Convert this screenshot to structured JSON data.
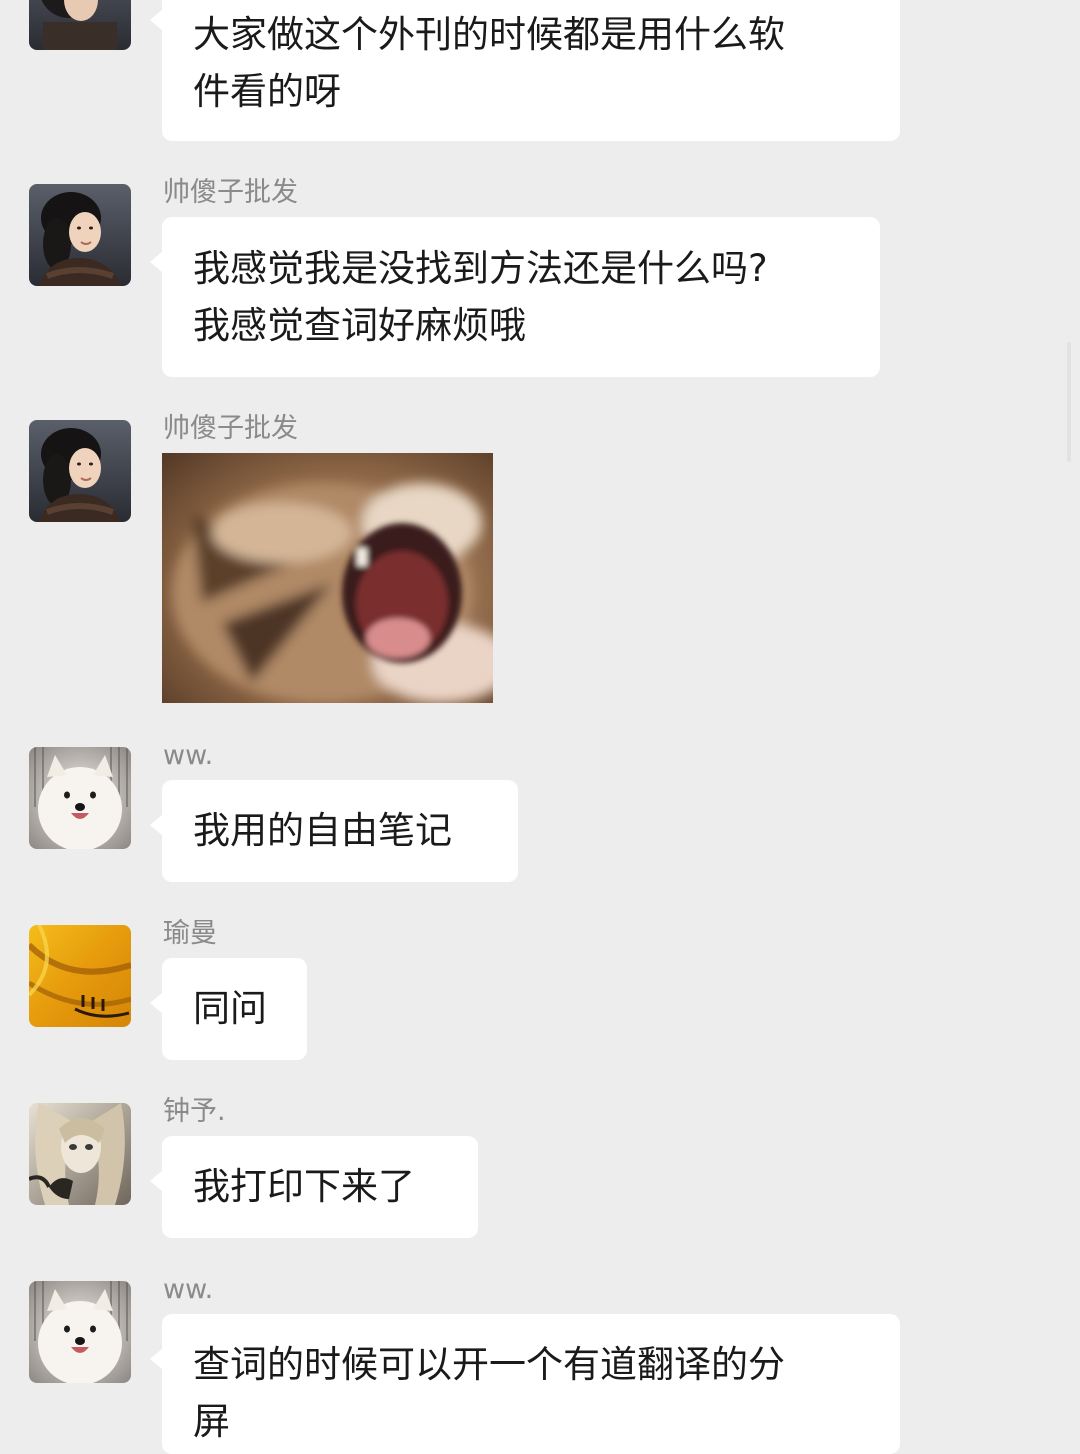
{
  "messages": [
    {
      "id": "m1",
      "sender": "",
      "type": "text",
      "lines": [
        "大家做这个外刊的时候都是用什么软",
        "件看的呀"
      ]
    },
    {
      "id": "m2",
      "sender": "帅傻子批发",
      "type": "text",
      "lines": [
        "我感觉我是没找到方法还是什么吗?",
        "我感觉查词好麻烦哦"
      ]
    },
    {
      "id": "m3",
      "sender": "帅傻子批发",
      "type": "image",
      "image": "screaming-cat-sticker"
    },
    {
      "id": "m4",
      "sender": "ww.",
      "type": "text",
      "lines": [
        "我用的自由笔记"
      ]
    },
    {
      "id": "m5",
      "sender": "瑜曼",
      "type": "text",
      "lines": [
        "同问"
      ]
    },
    {
      "id": "m6",
      "sender": "钟予.",
      "type": "text",
      "lines": [
        "我打印下来了"
      ]
    },
    {
      "id": "m7",
      "sender": "ww.",
      "type": "text",
      "lines": [
        "查词的时候可以开一个有道翻译的分",
        "屏"
      ]
    }
  ],
  "avatars": {
    "m1": "woman-portrait-avatar",
    "m2": "woman-portrait-avatar",
    "m3": "woman-portrait-avatar",
    "m4": "white-dog-avatar",
    "m5": "yellow-abstract-avatar",
    "m6": "anime-girl-avatar",
    "m7": "white-dog-avatar"
  },
  "colors": {
    "background": "#ededed",
    "bubble": "#ffffff",
    "sender_name": "#8a8a8a",
    "message_text": "#1a1a1a"
  }
}
